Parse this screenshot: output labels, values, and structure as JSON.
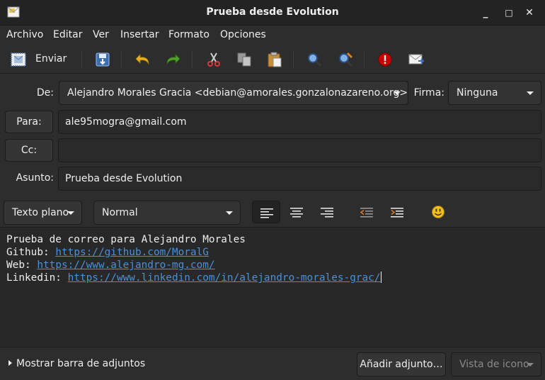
{
  "window": {
    "title": "Prueba desde Evolution",
    "minimize_glyph": "_",
    "maximize_glyph": "□",
    "close_glyph": "✕"
  },
  "menubar": {
    "items": [
      "Archivo",
      "Editar",
      "Ver",
      "Insertar",
      "Formato",
      "Opciones"
    ]
  },
  "toolbar": {
    "send_label": "Enviar",
    "icons": [
      "send-icon",
      "save-draft-icon",
      "undo-icon",
      "redo-icon",
      "cut-icon",
      "copy-icon",
      "paste-icon",
      "find-icon",
      "find-replace-icon",
      "priority-icon",
      "request-receipt-icon"
    ]
  },
  "header": {
    "from_label": "De:",
    "from_value": "Alejandro Morales Gracia <debian@amorales.gonzalonazareno.org>",
    "signature_label": "Firma:",
    "signature_value": "Ninguna",
    "to_button": "Para:",
    "to_value": "ale95mogra@gmail.com",
    "cc_button": "Cc:",
    "cc_value": "",
    "subject_label": "Asunto:",
    "subject_value": "Prueba desde Evolution"
  },
  "format": {
    "mode_value": "Texto plano",
    "paragraph_style": "Normal",
    "alignment_selected": "left",
    "icons": [
      "align-left-icon",
      "align-center-icon",
      "align-right-icon",
      "unindent-icon",
      "indent-icon",
      "smiley-icon"
    ]
  },
  "body": {
    "line1": "Prueba de correo para Alejandro Morales",
    "github_label": "Github:",
    "github_url": "https://github.com/MoralG",
    "web_label": "Web:",
    "web_url": "https://www.alejandro-mg.com/",
    "linkedin_label": "Linkedin:",
    "linkedin_url": "https://www.linkedin.com/in/alejandro-morales-grac/"
  },
  "footer": {
    "attachment_bar_label": "Mostrar barra de adjuntos",
    "add_attachment_button": "Añadir adjunto…",
    "view_mode_value": "Vista de icono"
  },
  "colors": {
    "link": "#4a90d9",
    "background": "#2d2d2d",
    "priority_red": "#cc0000"
  }
}
